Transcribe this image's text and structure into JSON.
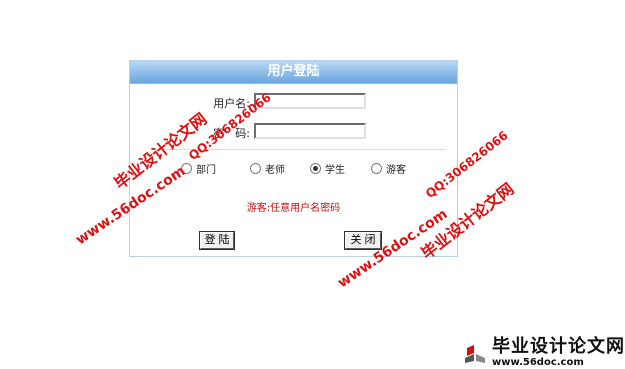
{
  "panel": {
    "title": "用户登陆",
    "username_label": "用户名:",
    "username_value": "",
    "password_label": "密　码:",
    "password_value": "",
    "roles": [
      {
        "label": "部门",
        "checked": false
      },
      {
        "label": "老师",
        "checked": false
      },
      {
        "label": "学生",
        "checked": true
      },
      {
        "label": "游客",
        "checked": false
      }
    ],
    "hint": "游客:任意用户名密码",
    "login_button": "登 陆",
    "close_button": "关 闭"
  },
  "watermarks": {
    "site_name": "毕业设计论文网",
    "qq": "QQ:306826066",
    "url": "www.56doc.com"
  },
  "brand": {
    "name": "毕业设计论文网",
    "url": "www.56doc.com"
  },
  "colors": {
    "title_bar": "#6aa6de",
    "hint_text": "#c01010",
    "watermark": "#d11111"
  }
}
